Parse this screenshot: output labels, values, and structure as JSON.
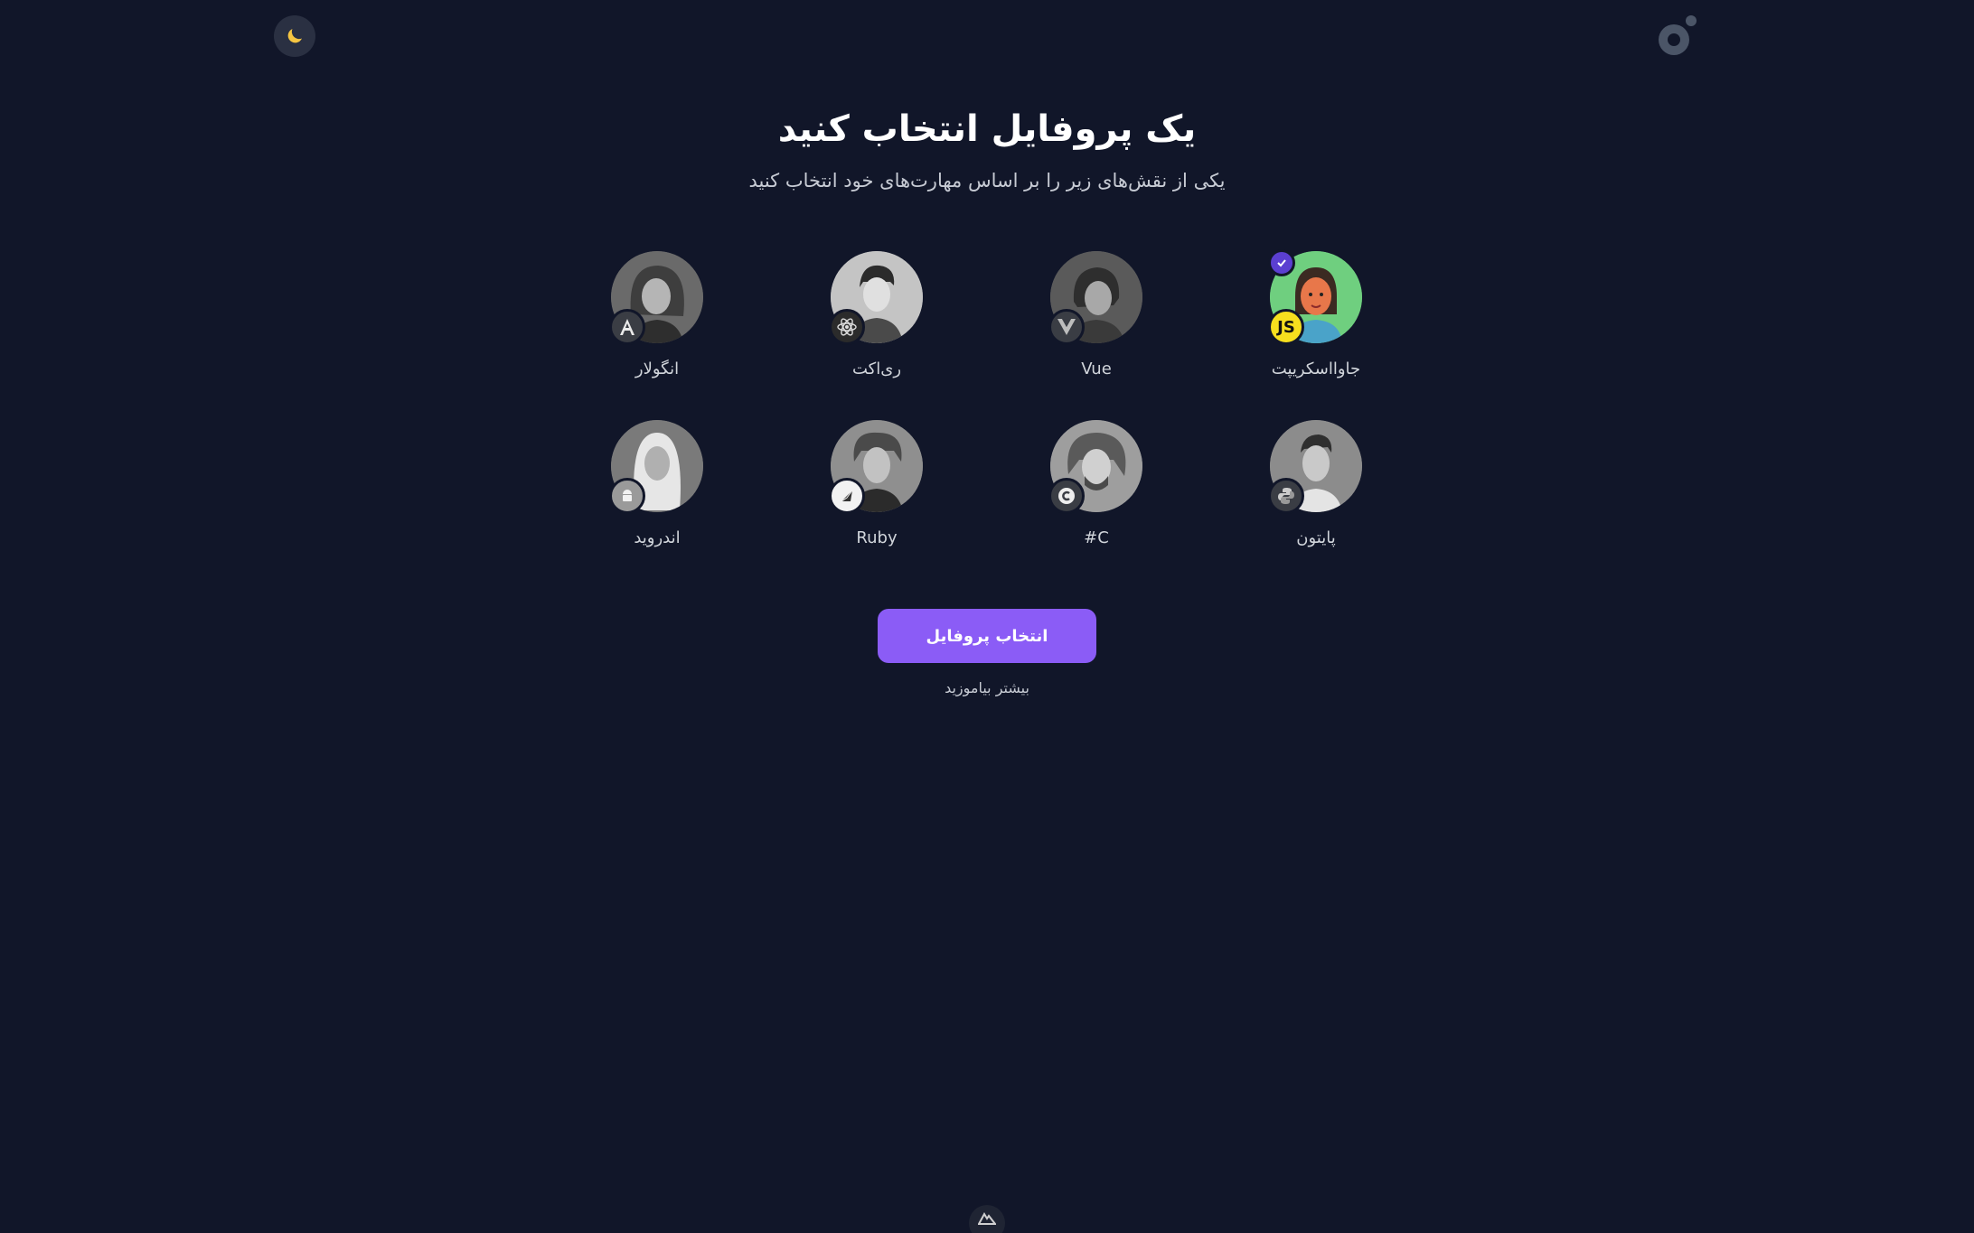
{
  "header": {
    "theme_toggle_icon": "moon-icon",
    "logo_icon": "brand-logo-icon"
  },
  "main": {
    "title": "یک پروفایل انتخاب کنید",
    "subtitle": "یکی از نقش‌های زیر را بر اساس مهارت‌های خود انتخاب کنید"
  },
  "profiles": [
    {
      "label": "جاوااسکریپت",
      "icon": "javascript-icon",
      "selected": true
    },
    {
      "label": "Vue",
      "icon": "vue-icon",
      "selected": false
    },
    {
      "label": "ری‌اکت",
      "icon": "react-icon",
      "selected": false
    },
    {
      "label": "انگولار",
      "icon": "angular-icon",
      "selected": false
    },
    {
      "label": "پایتون",
      "icon": "python-icon",
      "selected": false
    },
    {
      "label": "#C",
      "icon": "csharp-icon",
      "selected": false
    },
    {
      "label": "Ruby",
      "icon": "ruby-icon",
      "selected": false
    },
    {
      "label": "اندروید",
      "icon": "android-icon",
      "selected": false
    }
  ],
  "actions": {
    "select_label": "انتخاب پروفایل",
    "learn_more_label": "بیشتر بیاموزید"
  },
  "footer": {
    "icon": "nuxt-icon"
  },
  "colors": {
    "background": "#111629",
    "accent": "#8b5cf6",
    "selected_avatar_bg": "#6fcf7f",
    "js_badge": "#f7df1e"
  }
}
